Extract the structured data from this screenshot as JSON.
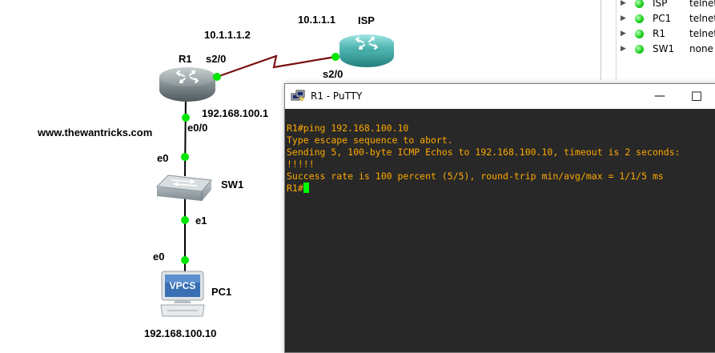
{
  "topology": {
    "watermark": "www.thewantricks.com",
    "devices": {
      "isp": {
        "name": "ISP",
        "address": "10.1.1.1",
        "interface": "s2/0"
      },
      "r1": {
        "name": "R1",
        "serial_address": "10.1.1.1.2",
        "serial_interface": "s2/0",
        "lan_address": "192.168.100.1",
        "lan_interface": "e0/0"
      },
      "sw1": {
        "name": "SW1",
        "uplink_port": "e0",
        "downlink_port": "e1"
      },
      "pc1": {
        "name": "PC1",
        "logo_text": "VPCS",
        "port": "e0",
        "address": "192.168.100.10"
      }
    }
  },
  "summary": {
    "rows": [
      {
        "name": "ISP",
        "console": "telnet"
      },
      {
        "name": "PC1",
        "console": "telnet"
      },
      {
        "name": "R1",
        "console": "telnet"
      },
      {
        "name": "SW1",
        "console": "none"
      }
    ]
  },
  "putty": {
    "title": "R1 - PuTTY",
    "minimize": "—",
    "maximize": "☐",
    "lines": [
      "R1#ping 192.168.100.10",
      "Type escape sequence to abort.",
      "Sending 5, 100-byte ICMP Echos to 192.168.100.10, timeout is 2 seconds:",
      "!!!!!",
      "Success rate is 100 percent (5/5), round-trip min/avg/max = 1/1/5 ms"
    ],
    "prompt": "R1#"
  },
  "colors": {
    "link_dot": "#00e600",
    "serial_link": "#7a1010",
    "terminal_bg": "#282828",
    "terminal_text": "#ffaa00",
    "cursor": "#00ff00"
  }
}
